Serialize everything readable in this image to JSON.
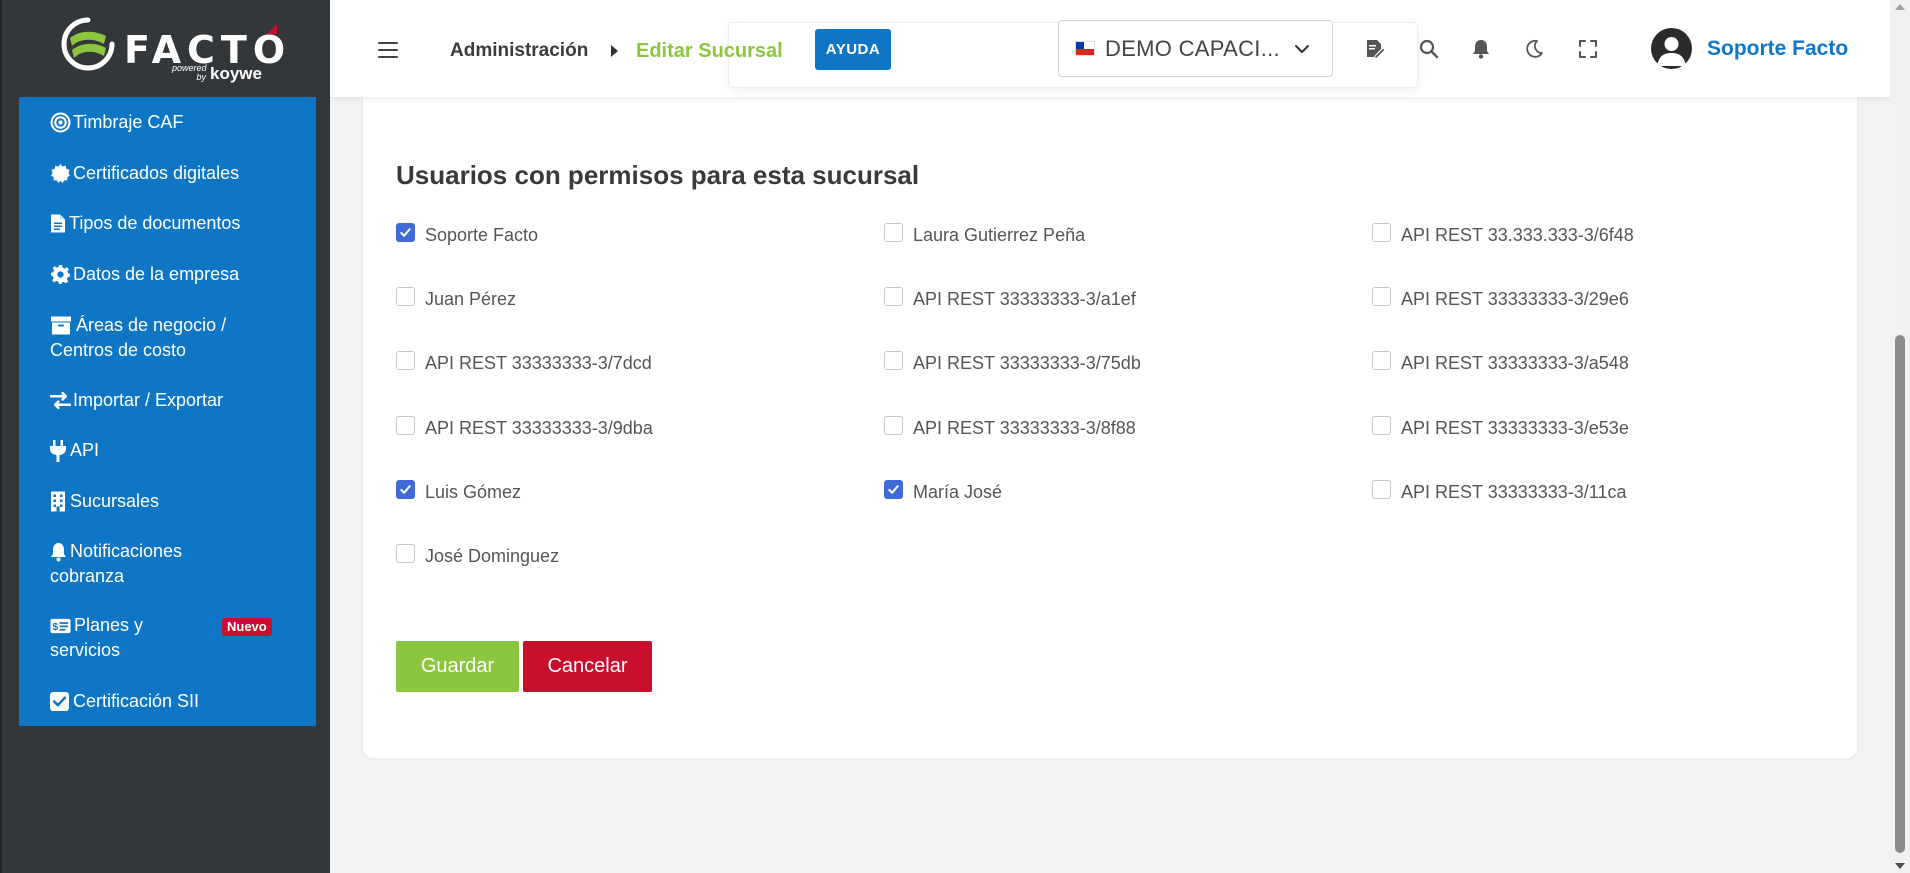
{
  "brand": {
    "logo_text": "FACTO",
    "powered_by": "powered by",
    "partner": "koywe",
    "accent_green": "#8cc63f",
    "accent_blue": "#0f76c6",
    "accent_red": "#c8102e"
  },
  "sidebar": {
    "items": [
      {
        "label": "Timbraje CAF",
        "icon": "target-icon"
      },
      {
        "label": "Certificados digitales",
        "icon": "certificate-icon"
      },
      {
        "label": "Tipos de documentos",
        "icon": "document-icon"
      },
      {
        "label": "Datos de la empresa",
        "icon": "gear-icon"
      },
      {
        "label": "Áreas de negocio / Centros de costo",
        "icon": "archive-icon"
      },
      {
        "label": "Importar / Exportar",
        "icon": "exchange-icon"
      },
      {
        "label": "API",
        "icon": "plug-icon"
      },
      {
        "label": "Sucursales",
        "icon": "building-icon"
      },
      {
        "label": "Notificaciones cobranza",
        "icon": "bell-icon"
      },
      {
        "label": "Planes y servicios contratados",
        "icon": "money-icon",
        "badge": "Nuevo"
      },
      {
        "label": "Certificación SII",
        "icon": "check-square-icon"
      }
    ]
  },
  "header": {
    "breadcrumb": {
      "parent": "Administración",
      "current": "Editar Sucursal"
    },
    "help_label": "AYUDA",
    "company": "DEMO CAPACI...",
    "user_name": "Soporte Facto"
  },
  "main": {
    "section_title": "Usuarios con permisos para esta sucursal",
    "users": [
      {
        "name": "Soporte Facto",
        "checked": true
      },
      {
        "name": "Laura Gutierrez Peña",
        "checked": false
      },
      {
        "name": "API REST 33.333.333-3/6f48",
        "checked": false
      },
      {
        "name": "Juan Pérez",
        "checked": false
      },
      {
        "name": "API REST 33333333-3/a1ef",
        "checked": false
      },
      {
        "name": "API REST 33333333-3/29e6",
        "checked": false
      },
      {
        "name": "API REST 33333333-3/7dcd",
        "checked": false
      },
      {
        "name": "API REST 33333333-3/75db",
        "checked": false
      },
      {
        "name": "API REST 33333333-3/a548",
        "checked": false
      },
      {
        "name": "API REST 33333333-3/9dba",
        "checked": false
      },
      {
        "name": "API REST 33333333-3/8f88",
        "checked": false
      },
      {
        "name": "API REST 33333333-3/e53e",
        "checked": false
      },
      {
        "name": "Luis Gómez",
        "checked": true
      },
      {
        "name": "María José",
        "checked": true
      },
      {
        "name": "API REST 33333333-3/11ca",
        "checked": false
      },
      {
        "name": "José Dominguez",
        "checked": false
      }
    ],
    "save_label": "Guardar",
    "cancel_label": "Cancelar"
  }
}
